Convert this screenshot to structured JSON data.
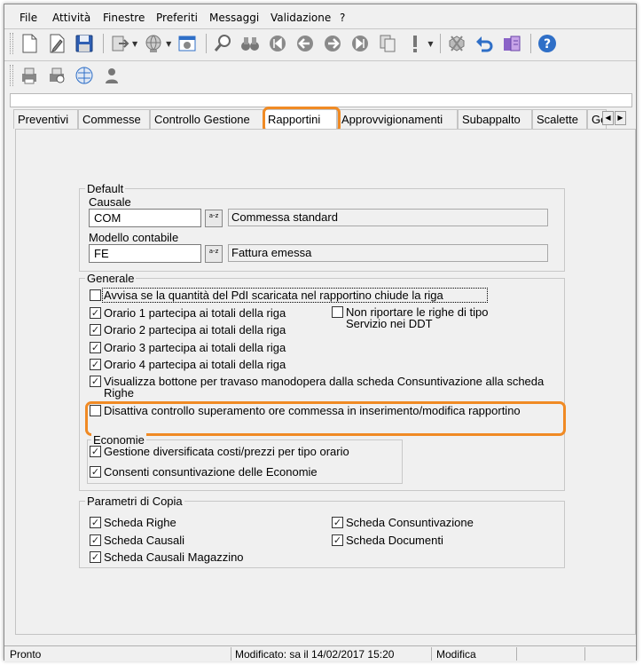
{
  "menu": [
    "File",
    "Attività",
    "Finestre",
    "Preferiti",
    "Messaggi",
    "Validazione",
    "?"
  ],
  "toolbar1_icons": [
    "new-document-icon",
    "edit-document-icon",
    "save-icon",
    "export-icon",
    "globe-icon",
    "settings-window-icon",
    "magnifier-icon",
    "binoculars-icon",
    "first-record-icon",
    "previous-record-icon",
    "next-record-icon",
    "last-record-icon",
    "copy-record-icon",
    "exclamation-icon",
    "delete-record-icon",
    "undo-icon",
    "filter-icon",
    "help-icon"
  ],
  "toolbar2_icons": [
    "printer-icon",
    "print-preview-icon",
    "network-icon",
    "user-icon"
  ],
  "tabs": [
    "Preventivi",
    "Commesse",
    "Controllo Gestione",
    "Rapportini",
    "Approvvigionamenti",
    "Subappalto",
    "Scalette",
    "Ge"
  ],
  "active_tab": "Rapportini",
  "default_group": {
    "title": "Default",
    "causale_label": "Causale",
    "causale_value": "COM",
    "causale_desc": "Commessa standard",
    "modello_label": "Modello contabile",
    "modello_value": "FE",
    "modello_desc": "Fattura emessa",
    "lookup_text": "a-z"
  },
  "generale_group": {
    "title": "Generale",
    "options": [
      {
        "label": "Avvisa se la quantità del PdI scaricata nel rapportino chiude la riga",
        "checked": false
      },
      {
        "label": "Orario 1 partecipa ai totali della riga",
        "checked": true
      },
      {
        "label": "Orario 2 partecipa ai totali della riga",
        "checked": true
      },
      {
        "label": "Orario 3 partecipa ai totali della riga",
        "checked": true
      },
      {
        "label": "Orario 4 partecipa ai totali della riga",
        "checked": true
      },
      {
        "label": "Visualizza bottone per travaso manodopera dalla scheda Consuntivazione alla scheda Righe",
        "checked": true
      },
      {
        "label": "Disattiva controllo superamento ore commessa in inserimento/modifica rapportino",
        "checked": false
      }
    ],
    "side_option": {
      "label": "Non riportare le righe di tipo Servizio nei DDT",
      "checked": false
    }
  },
  "economie_group": {
    "title": "Economie",
    "options": [
      {
        "label": "Gestione diversificata costi/prezzi per tipo orario",
        "checked": true
      },
      {
        "label": "Consenti consuntivazione delle Economie",
        "checked": true
      }
    ]
  },
  "copia_group": {
    "title": "Parametri di Copia",
    "left": [
      {
        "label": "Scheda Righe",
        "checked": true
      },
      {
        "label": "Scheda Causali",
        "checked": true
      },
      {
        "label": "Scheda Causali Magazzino",
        "checked": true
      }
    ],
    "right": [
      {
        "label": "Scheda Consuntivazione",
        "checked": true
      },
      {
        "label": "Scheda Documenti",
        "checked": true
      }
    ]
  },
  "status": {
    "state": "Pronto",
    "modified": "Modificato: sa il 14/02/2017 15:20",
    "mode": "Modifica"
  },
  "colors": {
    "highlight": "#f08a24",
    "icon_blue": "#2f6fc7"
  }
}
